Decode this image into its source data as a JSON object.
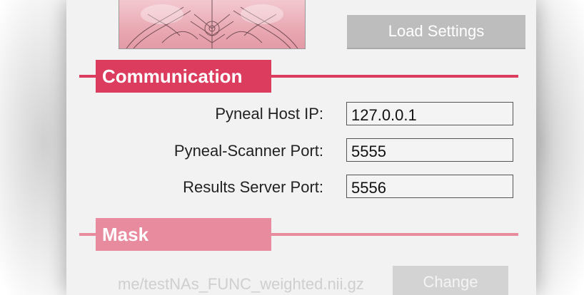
{
  "header": {
    "load_settings_label": "Load Settings"
  },
  "sections": {
    "communication": "Communication",
    "mask": "Mask"
  },
  "communication": {
    "fields": [
      {
        "label": "Pyneal Host IP:",
        "value": "127.0.0.1"
      },
      {
        "label": "Pyneal-Scanner Port:",
        "value": "5555"
      },
      {
        "label": "Results Server Port:",
        "value": "5556"
      }
    ]
  },
  "mask": {
    "path": "me/testNAs_FUNC_weighted.nii.gz",
    "change_label": "Change"
  },
  "colors": {
    "accent": "#dc3c5e",
    "accent_light": "#e88b9f",
    "button_bg": "#bdbdbd",
    "panel_bg": "#f2f2f2"
  }
}
